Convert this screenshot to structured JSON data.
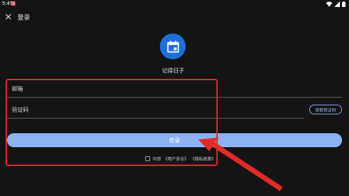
{
  "status_bar": {
    "time": "5:49"
  },
  "header": {
    "title": "登录"
  },
  "app": {
    "name": "记得日子",
    "brand_color": "#1e6fd9"
  },
  "form": {
    "email_label": "邮箱",
    "code_label": "验证码",
    "get_code_label": "获取验证码",
    "login_label": "登录"
  },
  "agreement": {
    "agree_label": "同意",
    "user_agreement": "《用户协议》",
    "privacy_policy": "《隐私政策》"
  },
  "annotation": {
    "color": "#e12a2a"
  }
}
